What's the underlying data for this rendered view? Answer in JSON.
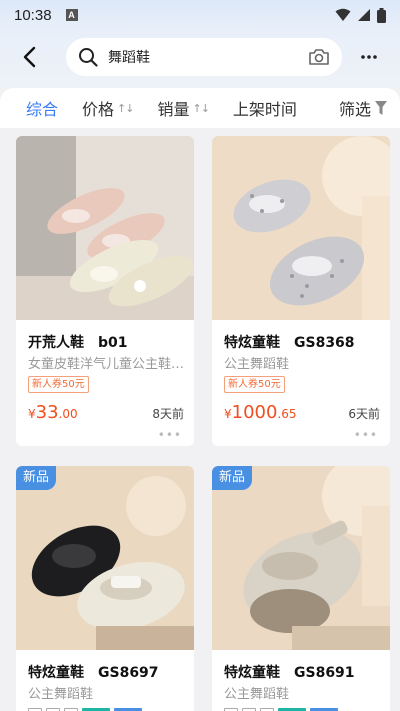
{
  "status_bar": {
    "time": "10:38",
    "notification_label": "A"
  },
  "search": {
    "query": "舞蹈鞋"
  },
  "sort_tabs": {
    "comprehensive": "综合",
    "price": "价格",
    "sales": "销量",
    "listing_time": "上架时间",
    "filter": "筛选",
    "sort_arrows": "↑↓"
  },
  "products": [
    {
      "title": "开荒人鞋　b01",
      "subtitle": "女童皮鞋洋气儿童公主鞋…",
      "coupon": "新人券50元",
      "price_currency": "¥",
      "price_int": "33",
      "price_dec": ".00",
      "time_ago": "8天前",
      "badge": ""
    },
    {
      "title": "特炫童鞋　GS8368",
      "subtitle": "公主舞蹈鞋",
      "coupon": "新人券50元",
      "price_currency": "¥",
      "price_int": "1000",
      "price_dec": ".65",
      "time_ago": "6天前",
      "badge": ""
    },
    {
      "title": "特炫童鞋　GS8697",
      "subtitle": "公主舞蹈鞋",
      "badge": "新品"
    },
    {
      "title": "特炫童鞋　GS8691",
      "subtitle": "公主舞蹈鞋",
      "badge": "新品"
    }
  ],
  "more_dots": "•••",
  "colors": {
    "accent": "#3b7cf0",
    "price": "#f04e1e",
    "badge": "#4a90e2"
  }
}
